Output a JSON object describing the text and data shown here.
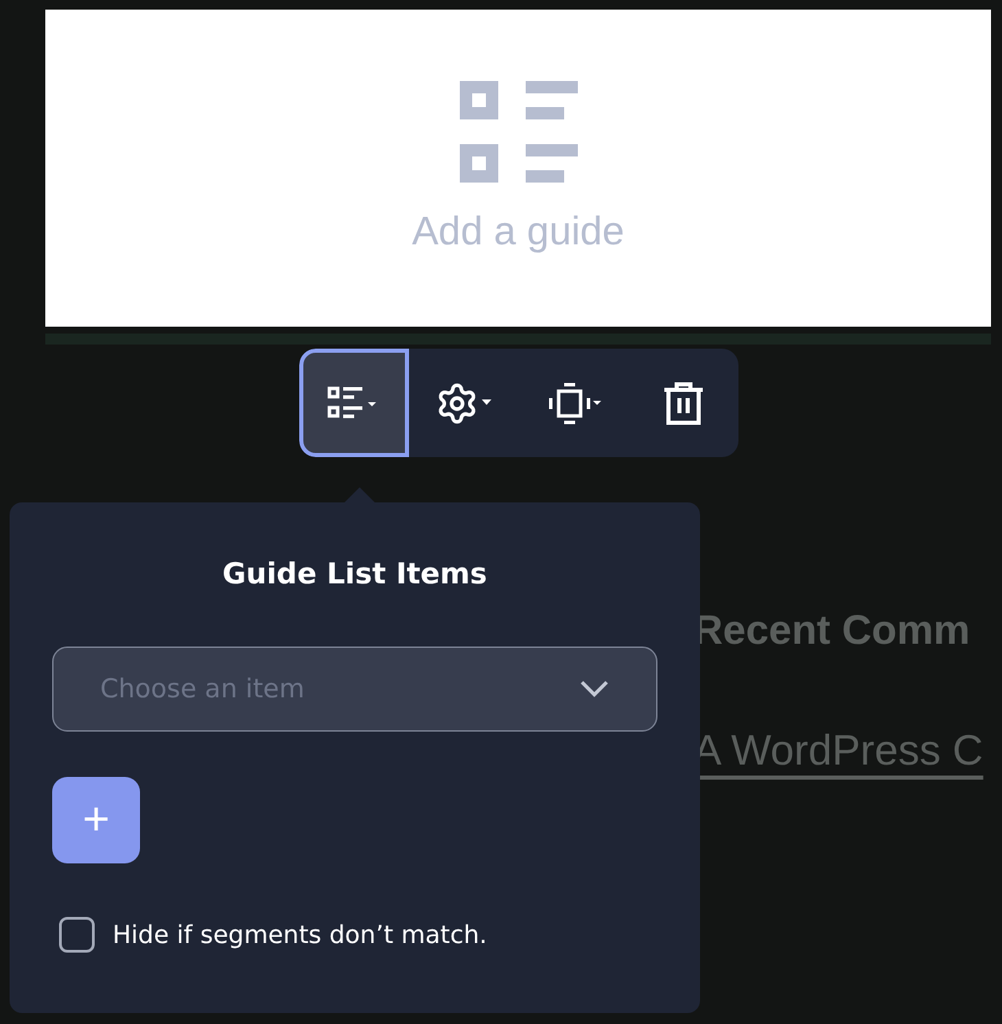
{
  "guide_block": {
    "placeholder_text": "Add a guide"
  },
  "toolbar": [
    {
      "kind": "list",
      "selected": true
    },
    {
      "kind": "settings",
      "selected": false
    },
    {
      "kind": "align",
      "selected": false
    },
    {
      "kind": "delete",
      "selected": false
    }
  ],
  "background_page": {
    "heading": "Recent Comm",
    "link": "A WordPress C"
  },
  "popover": {
    "title": "Guide List Items",
    "select": {
      "placeholder": "Choose an item"
    },
    "add_button": "+",
    "checkbox": {
      "label": "Hide if segments don’t match.",
      "checked": false
    }
  }
}
